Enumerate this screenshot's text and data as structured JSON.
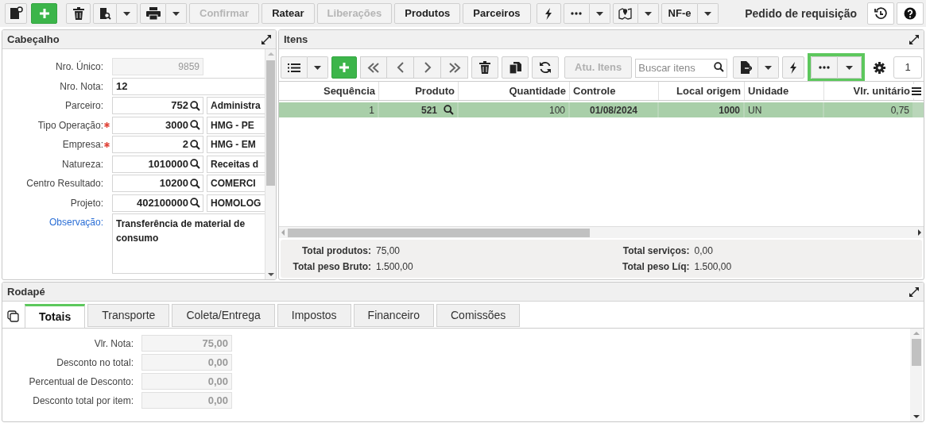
{
  "toolbar": {
    "buttons": [
      {
        "label": "Confirmar",
        "kind": "text",
        "disabled": true
      },
      {
        "label": "Ratear",
        "kind": "text",
        "disabled": false
      },
      {
        "label": "Liberações",
        "kind": "text",
        "disabled": true
      },
      {
        "label": "Produtos",
        "kind": "text",
        "disabled": false
      },
      {
        "label": "Parceiros",
        "kind": "text",
        "disabled": false
      },
      {
        "label": "NF-e",
        "kind": "split",
        "disabled": false
      }
    ],
    "title": "Pedido de requisição"
  },
  "header_panel": {
    "title": "Cabeçalho",
    "fields": [
      {
        "label": "Nro. Único:",
        "kind": "readonly",
        "value": "9859",
        "required": false
      },
      {
        "label": "Nro. Nota:",
        "kind": "text",
        "value": "12",
        "required": false
      },
      {
        "label": "Parceiro:",
        "kind": "lookup",
        "value": "752",
        "description": "Administra",
        "required": false
      },
      {
        "label": "Tipo Operação:",
        "kind": "lookup",
        "value": "3000",
        "description": "HMG - PE",
        "required": true
      },
      {
        "label": "Empresa:",
        "kind": "lookup",
        "value": "2",
        "description": "HMG - EM",
        "required": true
      },
      {
        "label": "Natureza:",
        "kind": "lookup",
        "value": "1010000",
        "description": "Receitas d",
        "required": false
      },
      {
        "label": "Centro Resultado:",
        "kind": "lookup",
        "value": "10200",
        "description": "COMERCI",
        "required": false
      },
      {
        "label": "Projeto:",
        "kind": "lookup",
        "value": "402100000",
        "description": "HOMOLOG",
        "required": false
      },
      {
        "label": "Observação:",
        "kind": "memo",
        "value": "Transferência de material de consumo",
        "required": false
      }
    ]
  },
  "items_panel": {
    "title": "Itens",
    "update_button": {
      "label": "Atu. Itens",
      "disabled": true
    },
    "search": {
      "placeholder": "Buscar itens"
    },
    "page": "1",
    "table": {
      "columns": [
        {
          "label": "Sequência"
        },
        {
          "label": "Produto"
        },
        {
          "label": "Quantidade"
        },
        {
          "label": "Controle"
        },
        {
          "label": "Local origem"
        },
        {
          "label": "Unidade"
        },
        {
          "label": "Vlr. unitário"
        }
      ],
      "rows": [
        {
          "selected": true,
          "cells": [
            "1",
            "521",
            "100",
            "01/08/2024",
            "1000",
            "UN",
            "0,75"
          ]
        }
      ]
    },
    "totals": [
      {
        "label": "Total produtos:",
        "value": "75,00"
      },
      {
        "label": "Total serviços:",
        "value": "0,00"
      },
      {
        "label": "Total peso Bruto:",
        "value": "1.500,00"
      },
      {
        "label": "Total peso Líq:",
        "value": "1.500,00"
      }
    ]
  },
  "footer_panel": {
    "title": "Rodapé",
    "tabs": [
      {
        "label": "Totais",
        "selected": true
      },
      {
        "label": "Transporte",
        "selected": false
      },
      {
        "label": "Coleta/Entrega",
        "selected": false
      },
      {
        "label": "Impostos",
        "selected": false
      },
      {
        "label": "Financeiro",
        "selected": false
      },
      {
        "label": "Comissões",
        "selected": false
      }
    ],
    "fields": [
      {
        "label": "Vlr. Nota:",
        "value": "75,00"
      },
      {
        "label": "Desconto no total:",
        "value": "0,00"
      },
      {
        "label": "Percentual de Desconto:",
        "value": "0,00"
      },
      {
        "label": "Desconto total por item:",
        "value": "0,00"
      }
    ]
  }
}
